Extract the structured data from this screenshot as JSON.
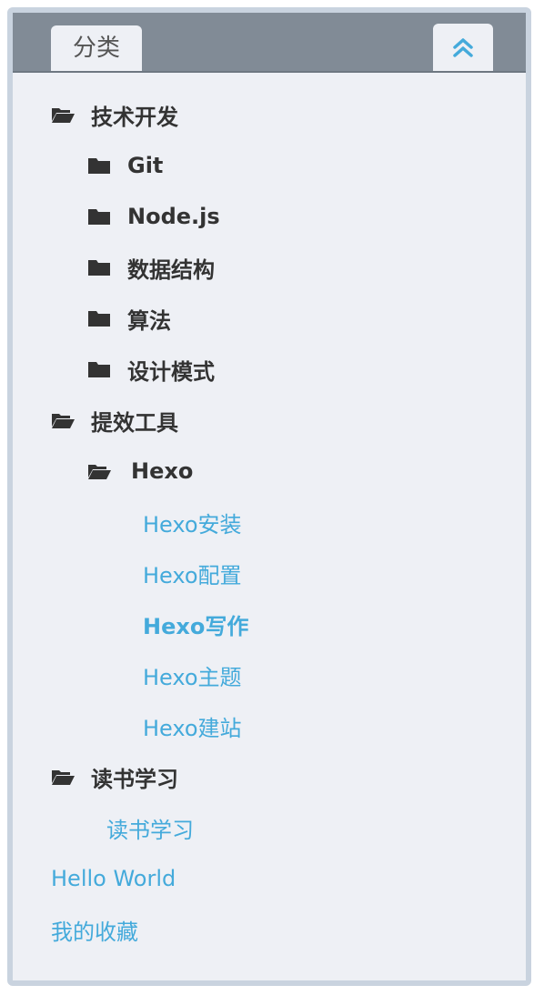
{
  "header": {
    "tab_label": "分类",
    "collapse_icon": "double-chevron-up-icon",
    "accent": "#44aadb"
  },
  "tree": {
    "tech": {
      "label": "技术开发",
      "children": [
        "Git",
        "Node.js",
        "数据结构",
        "算法",
        "设计模式"
      ]
    },
    "tools": {
      "label": "提效工具",
      "hexo": {
        "label": "Hexo",
        "posts": [
          "Hexo安装",
          "Hexo配置",
          "Hexo写作",
          "Hexo主题",
          "Hexo建站"
        ],
        "active": "Hexo写作"
      }
    },
    "reading": {
      "label": "读书学习",
      "posts": [
        "读书学习"
      ]
    },
    "root_links": [
      "Hello World",
      "我的收藏"
    ]
  }
}
